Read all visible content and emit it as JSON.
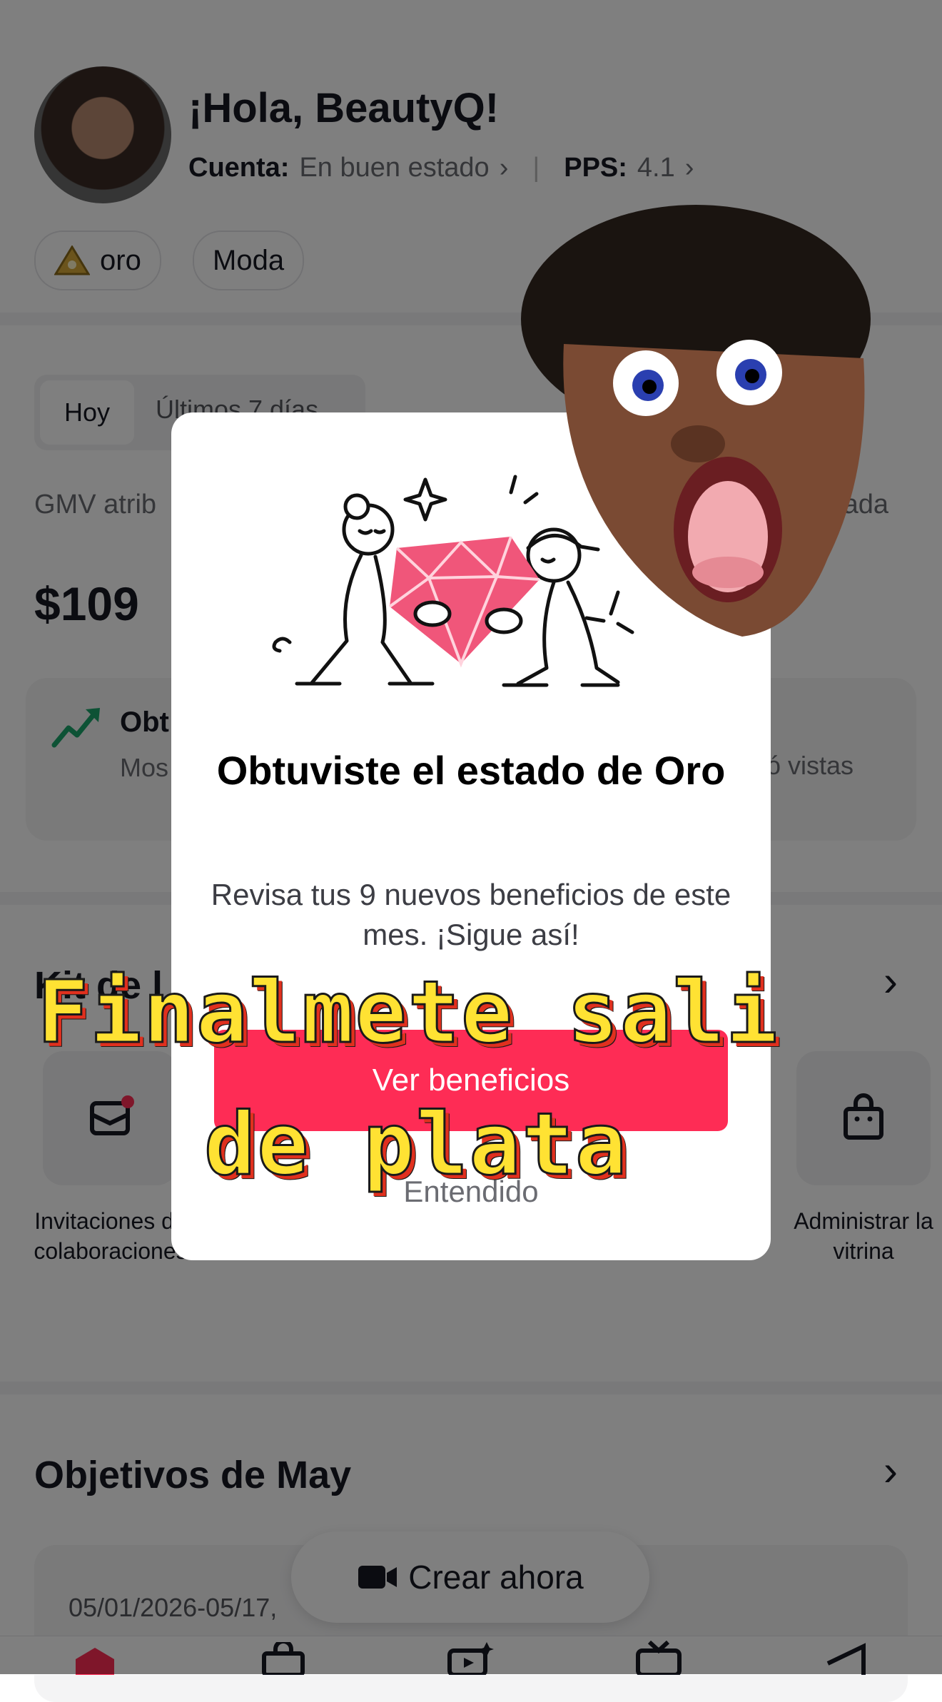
{
  "profile": {
    "greeting": "¡Hola, BeautyQ!",
    "account_label": "Cuenta:",
    "account_value": "En buen estado",
    "pps_label": "PPS:",
    "pps_value": "4.1",
    "tier_chip": "oro",
    "category_chip": "Moda"
  },
  "stats": {
    "tab_active": "Hoy",
    "tab_other": "Últimos 7 días",
    "gmv_label": "GMV atrib",
    "right_label": "mada",
    "gmv_value": "$109"
  },
  "insight_card": {
    "title": "Obt",
    "text": "Mos adic",
    "right_text": "ó vistas"
  },
  "tools": {
    "section_title": "Kit de l",
    "items": [
      {
        "label": "Invitaciones de colaboraciones",
        "icon": "mail-icon"
      },
      {
        "label": "Administrar la vitrina",
        "icon": "bag-icon"
      }
    ]
  },
  "goals": {
    "section_title": "Objetivos de May",
    "date_range": "05/01/2026-05/17,"
  },
  "fab": {
    "label": "Crear ahora",
    "icon": "video-camera-icon"
  },
  "modal": {
    "title": "Obtuviste el estado de Oro",
    "body": "Revisa tus 9 nuevos beneficios de este mes. ¡Sigue así!",
    "primary_button": "Ver beneficios",
    "secondary_button": "Entendido"
  },
  "caption": {
    "line1": "Finalmete sali",
    "line2": "de plata"
  },
  "colors": {
    "accent": "#fe2c55",
    "caption_fill": "#ffe233",
    "caption_shadow": "#e0301e"
  }
}
